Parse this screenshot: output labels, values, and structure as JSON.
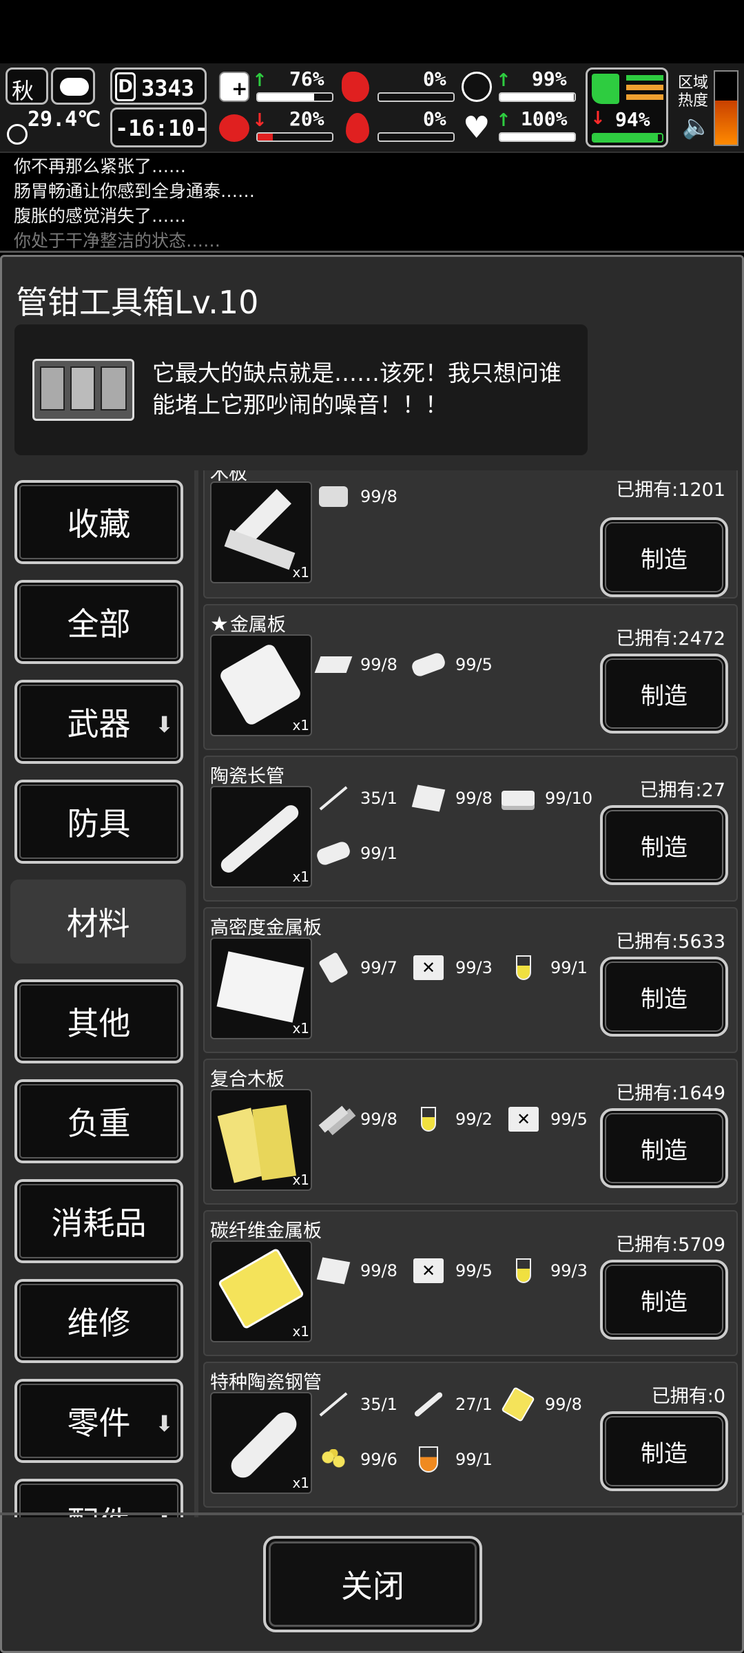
{
  "hud": {
    "season": "秋",
    "temperature": "29.4℃",
    "day": "3343",
    "time": "-16:10-",
    "stats": [
      {
        "name": "health",
        "value": "76%",
        "trend": "up",
        "fill": 0.76
      },
      {
        "name": "hunger",
        "value": "0%",
        "trend": "none",
        "fill": 0
      },
      {
        "name": "thirst-shield",
        "value": "99%",
        "trend": "up",
        "fill": 0.99
      },
      {
        "name": "mental",
        "value": "20%",
        "trend": "down",
        "fill": 0.2
      },
      {
        "name": "blood-loss",
        "value": "0%",
        "trend": "none",
        "fill": 0
      },
      {
        "name": "heart",
        "value": "100%",
        "trend": "up",
        "fill": 1.0
      },
      {
        "name": "stamina",
        "value": "94%",
        "trend": "down",
        "fill": 0.94
      }
    ],
    "zone_heat_label_line1": "区域",
    "zone_heat_label_line2": "热度"
  },
  "log": [
    "你不再那么紧张了……",
    "肠胃畅通让你感到全身通泰……",
    "腹胀的感觉消失了……",
    "你处于干净整洁的状态……"
  ],
  "panel": {
    "title": "管钳工具箱Lv.10",
    "description": "它最大的缺点就是……该死！我只想问谁能堵上它那吵闹的噪音！！！"
  },
  "categories": [
    {
      "label": "收藏",
      "arrow": false,
      "active": false
    },
    {
      "label": "全部",
      "arrow": false,
      "active": false
    },
    {
      "label": "武器",
      "arrow": true,
      "active": false
    },
    {
      "label": "防具",
      "arrow": false,
      "active": false
    },
    {
      "label": "材料",
      "arrow": false,
      "active": true
    },
    {
      "label": "其他",
      "arrow": false,
      "active": false
    },
    {
      "label": "负重",
      "arrow": false,
      "active": false
    },
    {
      "label": "消耗品",
      "arrow": false,
      "active": false
    },
    {
      "label": "维修",
      "arrow": false,
      "active": false
    },
    {
      "label": "零件",
      "arrow": true,
      "active": false
    },
    {
      "label": "配件",
      "arrow": true,
      "active": false
    }
  ],
  "recipes": [
    {
      "name": "木板",
      "owned": "已拥有:1201",
      "qty": "x1",
      "icon": "wood-plank-icon",
      "fav": false,
      "make": "制造",
      "ingredients": [
        {
          "icon": "log-icon",
          "amount": "99/8"
        }
      ]
    },
    {
      "name": "金属板",
      "owned": "已拥有:2472",
      "qty": "x1",
      "icon": "metal-plate-icon",
      "fav": true,
      "make": "制造",
      "ingredients": [
        {
          "icon": "metal-bar-icon",
          "amount": "99/8"
        },
        {
          "icon": "scrap-metal-icon",
          "amount": "99/5"
        }
      ]
    },
    {
      "name": "陶瓷长管",
      "owned": "已拥有:27",
      "qty": "x1",
      "icon": "ceramic-pipe-icon",
      "fav": false,
      "make": "制造",
      "ingredients": [
        {
          "icon": "thin-rod-icon",
          "amount": "35/1"
        },
        {
          "icon": "metal-sheet-icon",
          "amount": "99/8"
        },
        {
          "icon": "stacked-plates-icon",
          "amount": "99/10"
        },
        {
          "icon": "scrap-metal-icon",
          "amount": "99/1"
        }
      ]
    },
    {
      "name": "高密度金属板",
      "owned": "已拥有:5633",
      "qty": "x1",
      "icon": "dense-metal-sheet-icon",
      "fav": false,
      "make": "制造",
      "ingredients": [
        {
          "icon": "metal-plate-icon",
          "amount": "99/7"
        },
        {
          "icon": "chemical-can-icon",
          "amount": "99/3"
        },
        {
          "icon": "yellow-flask-icon",
          "amount": "99/1"
        }
      ]
    },
    {
      "name": "复合木板",
      "owned": "已拥有:1649",
      "qty": "x1",
      "icon": "composite-wood-icon",
      "fav": false,
      "make": "制造",
      "ingredients": [
        {
          "icon": "wood-plank-icon",
          "amount": "99/8"
        },
        {
          "icon": "yellow-flask-icon",
          "amount": "99/2"
        },
        {
          "icon": "chemical-can-icon",
          "amount": "99/5"
        }
      ]
    },
    {
      "name": "碳纤维金属板",
      "owned": "已拥有:5709",
      "qty": "x1",
      "icon": "carbon-fiber-plate-icon",
      "fav": false,
      "make": "制造",
      "ingredients": [
        {
          "icon": "metal-sheet-icon",
          "amount": "99/8"
        },
        {
          "icon": "chemical-can-icon",
          "amount": "99/5"
        },
        {
          "icon": "yellow-flask-icon",
          "amount": "99/3"
        }
      ]
    },
    {
      "name": "特种陶瓷钢管",
      "owned": "已拥有:0",
      "qty": "x1",
      "icon": "steel-pipe-icon",
      "fav": false,
      "make": "制造",
      "ingredients": [
        {
          "icon": "thin-rod-icon",
          "amount": "35/1"
        },
        {
          "icon": "thin-pipe-icon",
          "amount": "27/1"
        },
        {
          "icon": "gold-plate-icon",
          "amount": "99/8"
        },
        {
          "icon": "gold-nuggets-icon",
          "amount": "99/6"
        },
        {
          "icon": "orange-flask-icon",
          "amount": "99/1"
        }
      ]
    }
  ],
  "close_label": "关闭"
}
